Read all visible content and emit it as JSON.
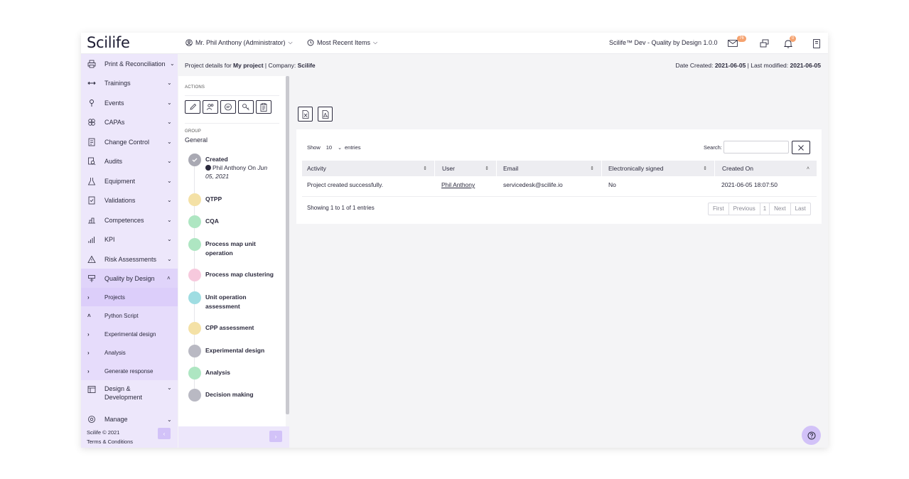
{
  "topbar": {
    "logo": "Scilife",
    "user": "Mr. Phil Anthony (Administrator)",
    "recent": "Most Recent Items",
    "instance": "Scilife™ Dev - Quality by Design 1.0.0",
    "mail_count": "76",
    "notif_count": "0"
  },
  "sidebar": {
    "items": [
      {
        "label": "Print & Reconciliation",
        "icon": "print-icon"
      },
      {
        "label": "Trainings",
        "icon": "dumbbell-icon"
      },
      {
        "label": "Events",
        "icon": "pin-icon"
      },
      {
        "label": "CAPAs",
        "icon": "capa-icon"
      },
      {
        "label": "Change Control",
        "icon": "change-icon"
      },
      {
        "label": "Audits",
        "icon": "audit-icon"
      },
      {
        "label": "Equipment",
        "icon": "flask-icon"
      },
      {
        "label": "Validations",
        "icon": "check-doc-icon"
      },
      {
        "label": "Competences",
        "icon": "competence-icon"
      },
      {
        "label": "KPI",
        "icon": "chart-icon"
      },
      {
        "label": "Risk Assessments",
        "icon": "warning-icon"
      },
      {
        "label": "Quality by Design",
        "icon": "qbd-icon"
      }
    ],
    "subitems": [
      {
        "label": "Projects",
        "chev": "›"
      },
      {
        "label": "Python Script",
        "chev": "˄"
      },
      {
        "label": "Experimental design",
        "chev": "›"
      },
      {
        "label": "Analysis",
        "chev": "›"
      },
      {
        "label": "Generate response",
        "chev": "›"
      }
    ],
    "design_dev": "Design & Development",
    "manage": "Manage",
    "footer_copy": "Scilife © 2021",
    "footer_terms": "Terms & Conditions"
  },
  "header": {
    "prefix": "Project details for ",
    "project": "My project",
    "company_label": " | Company: ",
    "company": "Scilife",
    "created_label": "Date Created: ",
    "created": "2021-06-05",
    "modified_label": " | Last modified: ",
    "modified": "2021-06-05"
  },
  "panel": {
    "actions_label": "ACTIONS",
    "group_label": "GROUP",
    "group_value": "General",
    "steps": [
      {
        "label": "Created",
        "sub": "Phil Anthony On",
        "sub_date": "Jun 05, 2021",
        "color": "#a9a9b3"
      },
      {
        "label": "QTPP",
        "color": "#f4e1a6"
      },
      {
        "label": "CQA",
        "color": "#aee6c2"
      },
      {
        "label": "Process map unit operation",
        "color": "#aee6c2"
      },
      {
        "label": "Process map clustering",
        "color": "#f7c9dd"
      },
      {
        "label": "Unit operation assessment",
        "color": "#9fdde2"
      },
      {
        "label": "CPP assessment",
        "color": "#f4e1a6"
      },
      {
        "label": "Experimental design",
        "color": "#b9b9c3"
      },
      {
        "label": "Analysis",
        "color": "#aee6c2"
      },
      {
        "label": "Decision making",
        "color": "#b9b9c3"
      }
    ]
  },
  "table": {
    "show_label": "Show",
    "show_value": "10",
    "entries_label": "entries",
    "search_label": "Search:",
    "columns": [
      "Activity",
      "User",
      "Email",
      "Electronically signed",
      "Created On"
    ],
    "rows": [
      {
        "activity": "Project created successfully.",
        "user": "Phil Anthony",
        "email": "servicedesk@scilife.io",
        "signed": "No",
        "created": "2021-06-05 18:07:50"
      }
    ],
    "info": "Showing 1 to 1 of 1 entries",
    "pager": [
      "First",
      "Previous",
      "1",
      "Next",
      "Last"
    ]
  }
}
